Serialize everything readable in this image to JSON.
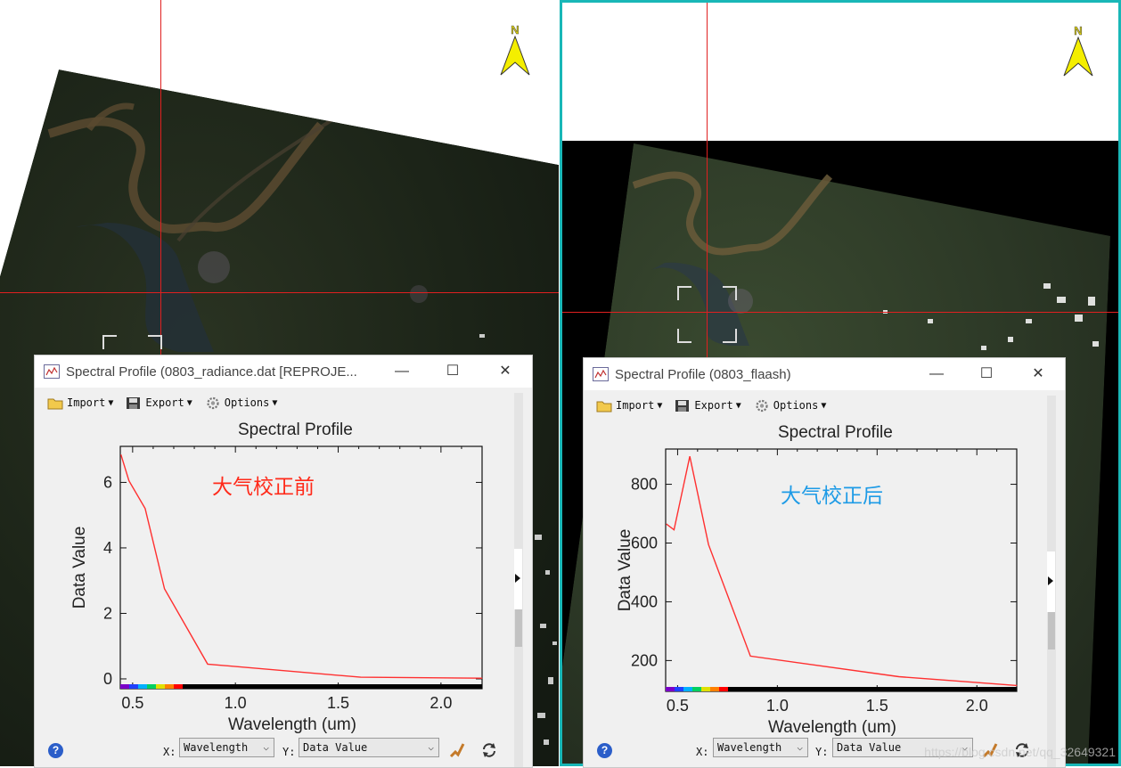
{
  "colors": {
    "crosshair": "#e02020",
    "left_annotation": "#ff2a1a",
    "right_annotation": "#1e9be6",
    "curve": "#ff3030",
    "view_border_active": "#19b7b7"
  },
  "north_arrow": {
    "label": "N"
  },
  "left_profile": {
    "window_title": "Spectral Profile (0803_radiance.dat [REPROJE...",
    "annotation": "大气校正前",
    "toolbar": {
      "import": "Import",
      "export": "Export",
      "options": "Options"
    },
    "x_axis_select_label": "X:",
    "x_axis_select_value": "Wavelength",
    "y_axis_select_label": "Y:",
    "y_axis_select_value": "Data Value",
    "chart_data": {
      "type": "line",
      "title": "Spectral Profile",
      "xlabel": "Wavelength (um)",
      "ylabel": "Data Value",
      "xlim": [
        0.44,
        2.2
      ],
      "ylim": [
        -0.3,
        7.1
      ],
      "x_ticks": [
        0.5,
        1.0,
        1.5,
        2.0
      ],
      "y_ticks": [
        0,
        2,
        4,
        6
      ],
      "x_tick_labels": [
        "0.5",
        "1.0",
        "1.5",
        "2.0"
      ],
      "y_tick_labels": [
        "0",
        "2",
        "4",
        "6"
      ],
      "x": [
        0.443,
        0.482,
        0.561,
        0.655,
        0.865,
        1.609,
        2.201
      ],
      "values": [
        6.85,
        6.05,
        5.2,
        2.75,
        0.45,
        0.05,
        0.02
      ]
    }
  },
  "right_profile": {
    "window_title": "Spectral Profile (0803_flaash)",
    "annotation": "大气校正后",
    "toolbar": {
      "import": "Import",
      "export": "Export",
      "options": "Options"
    },
    "x_axis_select_label": "X:",
    "x_axis_select_value": "Wavelength",
    "y_axis_select_label": "Y:",
    "y_axis_select_value": "Data Value",
    "chart_data": {
      "type": "line",
      "title": "Spectral Profile",
      "xlabel": "Wavelength (um)",
      "ylabel": "Data Value",
      "xlim": [
        0.44,
        2.2
      ],
      "ylim": [
        95,
        920
      ],
      "x_ticks": [
        0.5,
        1.0,
        1.5,
        2.0
      ],
      "y_ticks": [
        200,
        400,
        600,
        800
      ],
      "x_tick_labels": [
        "0.5",
        "1.0",
        "1.5",
        "2.0"
      ],
      "y_tick_labels": [
        "200",
        "400",
        "600",
        "800"
      ],
      "x": [
        0.443,
        0.482,
        0.561,
        0.655,
        0.865,
        1.609,
        2.201
      ],
      "values": [
        665,
        645,
        895,
        595,
        215,
        145,
        115
      ]
    }
  },
  "watermark": "https://blog.csdn.net/qq_32649321"
}
